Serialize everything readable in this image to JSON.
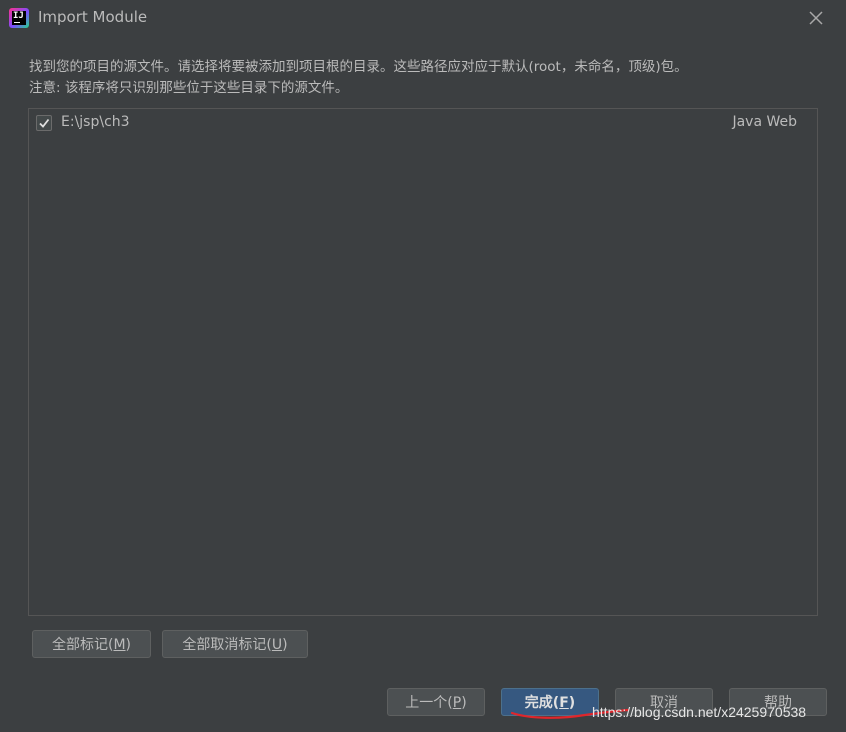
{
  "window": {
    "title": "Import Module",
    "close_icon": "close-icon"
  },
  "description": {
    "line1": "找到您的项目的源文件。请选择将要被添加到项目根的目录。这些路径应对应于默认(root，未命名，顶级)包。",
    "line2": "注意: 该程序将只识别那些位于这些目录下的源文件。"
  },
  "roots": [
    {
      "checked": true,
      "path": "E:\\jsp\\ch3",
      "type": "Java Web"
    }
  ],
  "buttons": {
    "mark_all": {
      "text": "全部标记(",
      "mnemonic": "M",
      "suffix": ")"
    },
    "unmark_all": {
      "text": "全部取消标记(",
      "mnemonic": "U",
      "suffix": ")"
    },
    "previous": {
      "text": "上一个(",
      "mnemonic": "P",
      "suffix": ")"
    },
    "finish": {
      "text": "完成(",
      "mnemonic": "F",
      "suffix": ")"
    },
    "cancel": {
      "text": "取消"
    },
    "help": {
      "text": "帮助"
    }
  },
  "watermark": "https://blog.csdn.net/x2425970538",
  "colors": {
    "background": "#3c3f41",
    "primary_button": "#365880",
    "annotation": "#e0262b"
  }
}
